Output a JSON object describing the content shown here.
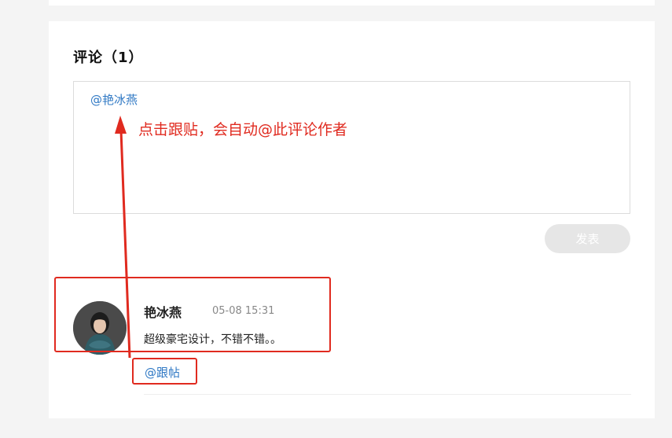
{
  "comments_section": {
    "title": "评论（1）",
    "editor_mention": "@艳冰燕",
    "submit_label": "发表"
  },
  "comment": {
    "author": "艳冰燕",
    "time": "05-08 15:31",
    "body": "超级豪宅设计，不错不错。。",
    "reply_label": "@跟帖"
  },
  "annotation": {
    "text": "点击跟贴，会自动@此评论作者"
  },
  "colors": {
    "link": "#2f78c4",
    "annotation": "#e02a1f",
    "button_disabled": "#e6e6e6"
  }
}
